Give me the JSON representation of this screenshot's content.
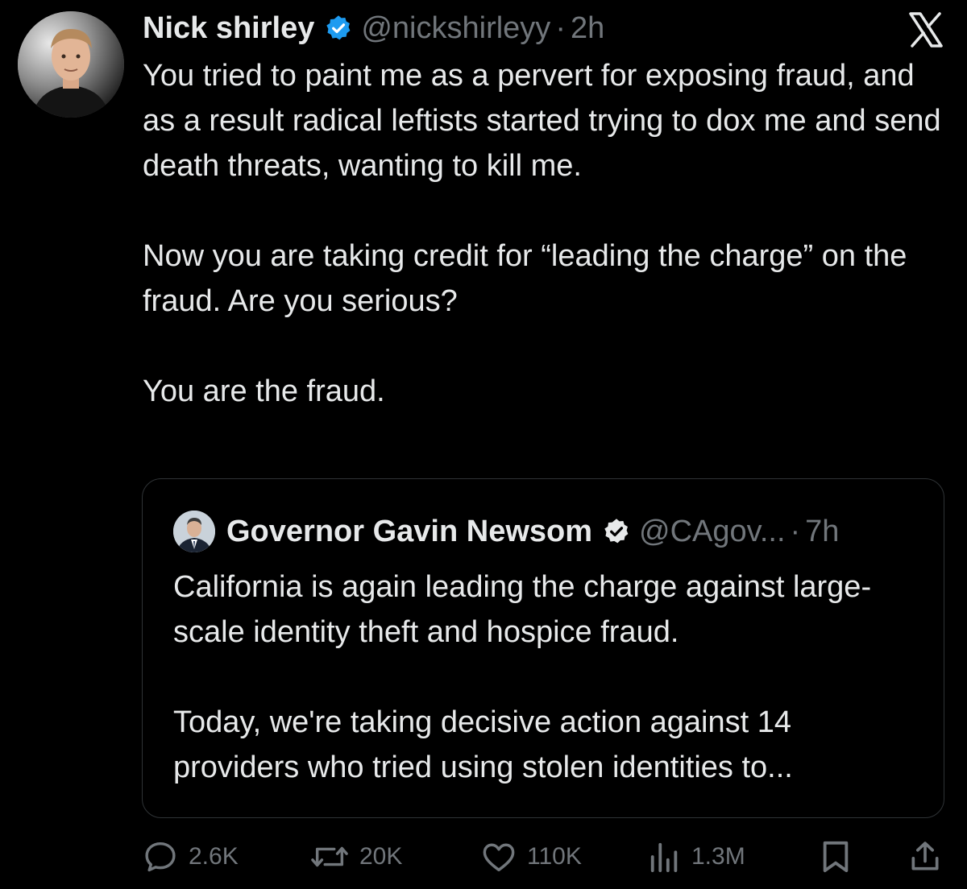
{
  "tweet": {
    "author_name": "Nick shirley",
    "handle": "@nickshirleyy",
    "separator": "·",
    "time": "2h",
    "paragraphs": [
      "You tried to paint me as a pervert for exposing fraud, and as a result radical leftists started trying to dox me and send death threats, wanting to kill me.",
      "Now you are taking credit for “leading the charge” on the fraud. Are you serious?",
      "You are the fraud."
    ],
    "verified_icon": "verified-badge-icon",
    "avatar_icon": "profile-photo"
  },
  "quote": {
    "author_name": "Governor Gavin Newsom",
    "handle": "@CAgov...",
    "separator": "·",
    "time": "7h",
    "paragraphs": [
      "California is again leading the charge against large-scale identity theft and hospice fraud.",
      "Today, we're taking decisive action against 14 providers who tried using stolen identities to..."
    ],
    "verified_icon": "verified-badge-icon"
  },
  "actions": {
    "replies": "2.6K",
    "reposts": "20K",
    "likes": "110K",
    "views": "1.3M"
  },
  "colors": {
    "background": "#000000",
    "text": "#e7e9ea",
    "secondary_text": "#71767b",
    "verified_blue": "#1d9bf0",
    "card_border": "#2f3336"
  }
}
